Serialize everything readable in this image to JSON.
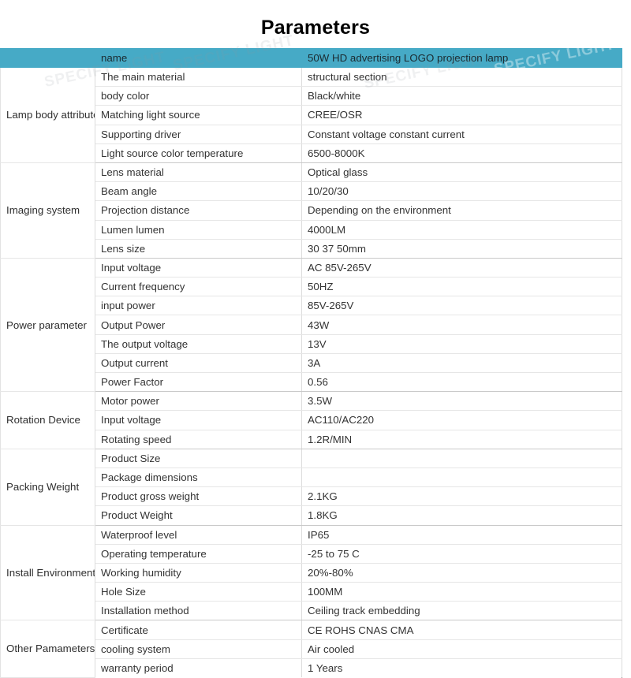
{
  "page": {
    "title": "Parameters",
    "header_bg_color": "#46aac6",
    "watermark_text": "SPECIFY LIGHT"
  },
  "watermarks": [
    {
      "text": "SPECIFY LIGHT"
    },
    {
      "text": "SPECIFY LIGHT"
    },
    {
      "text": "SPECIFY LIGHT"
    },
    {
      "text": "SPECIFY LIGHT"
    }
  ],
  "table": {
    "header": {
      "group": "",
      "key": "name",
      "value": "50W HD advertising LOGO projection lamp"
    },
    "groups": [
      {
        "label": "Lamp body attribute",
        "rows": [
          {
            "key": "The main material",
            "value": "structural section"
          },
          {
            "key": "body color",
            "value": "Black/white"
          },
          {
            "key": "Matching light source",
            "value": "CREE/OSR"
          },
          {
            "key": "Supporting driver",
            "value": "Constant voltage constant current"
          },
          {
            "key": "Light source color temperature",
            "value": "6500-8000K"
          }
        ]
      },
      {
        "label": "Imaging system",
        "rows": [
          {
            "key": "Lens material",
            "value": "Optical glass"
          },
          {
            "key": "Beam angle",
            "value": "10/20/30"
          },
          {
            "key": "Projection distance",
            "value": "Depending on the environment"
          },
          {
            "key": "Lumen lumen",
            "value": "4000LM"
          },
          {
            "key": "Lens size",
            "value": "30 37 50mm"
          }
        ]
      },
      {
        "label": "Power parameter",
        "rows": [
          {
            "key": "Input voltage",
            "value": "AC 85V-265V"
          },
          {
            "key": "Current frequency",
            "value": "50HZ"
          },
          {
            "key": "input power",
            "value": "85V-265V"
          },
          {
            "key": "Output Power",
            "value": "43W"
          },
          {
            "key": "The output voltage",
            "value": "13V"
          },
          {
            "key": "Output current",
            "value": "3A"
          },
          {
            "key": "Power Factor",
            "value": "0.56"
          }
        ]
      },
      {
        "label": "Rotation Device",
        "rows": [
          {
            "key": "Motor power",
            "value": "3.5W"
          },
          {
            "key": "Input voltage",
            "value": "AC110/AC220"
          },
          {
            "key": "Rotating speed",
            "value": "1.2R/MIN"
          }
        ]
      },
      {
        "label": "Packing Weight",
        "rows": [
          {
            "key": "Product Size",
            "value": ""
          },
          {
            "key": "Package dimensions",
            "value": ""
          },
          {
            "key": "Product gross weight",
            "value": "2.1KG"
          },
          {
            "key": "Product Weight",
            "value": "1.8KG"
          }
        ]
      },
      {
        "label": "Install Environment",
        "rows": [
          {
            "key": "Waterproof level",
            "value": "IP65"
          },
          {
            "key": "Operating temperature",
            "value": "-25 to 75 C"
          },
          {
            "key": "Working humidity",
            "value": "20%-80%"
          },
          {
            "key": "Hole Size",
            "value": "100MM"
          },
          {
            "key": "Installation method",
            "value": "Ceiling track embedding"
          }
        ]
      },
      {
        "label": "Other Pamameters",
        "rows": [
          {
            "key": "Certificate",
            "value": "CE ROHS CNAS CMA"
          },
          {
            "key": "cooling system",
            "value": "Air cooled"
          },
          {
            "key": "warranty period",
            "value": "1 Years"
          }
        ]
      }
    ]
  }
}
